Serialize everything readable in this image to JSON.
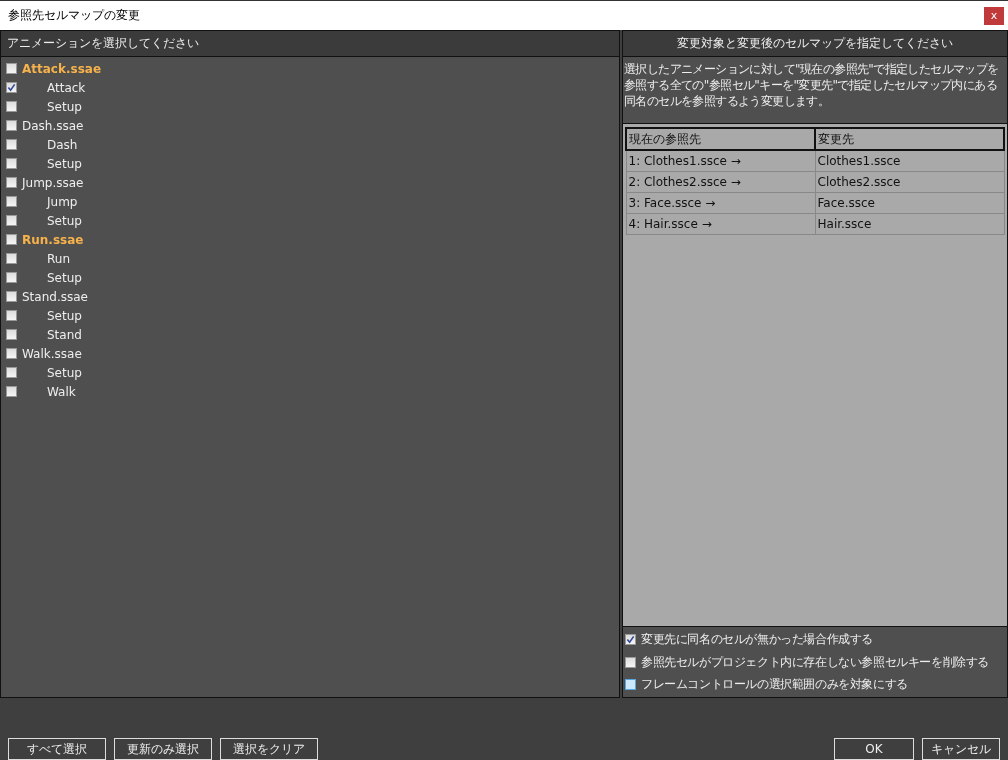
{
  "window": {
    "title": "参照先セルマップの変更",
    "close": "x"
  },
  "animation_panel": {
    "header": "アニメーションを選択してください",
    "files": [
      {
        "name": "Attack.ssae",
        "checked": false,
        "highlighted": true,
        "children": [
          {
            "name": "Attack",
            "checked": true
          },
          {
            "name": "Setup",
            "checked": false
          }
        ]
      },
      {
        "name": "Dash.ssae",
        "checked": false,
        "highlighted": false,
        "children": [
          {
            "name": "Dash",
            "checked": false
          },
          {
            "name": "Setup",
            "checked": false
          }
        ]
      },
      {
        "name": "Jump.ssae",
        "checked": false,
        "highlighted": false,
        "children": [
          {
            "name": "Jump",
            "checked": false
          },
          {
            "name": "Setup",
            "checked": false
          }
        ]
      },
      {
        "name": "Run.ssae",
        "checked": false,
        "highlighted": true,
        "children": [
          {
            "name": "Run",
            "checked": false
          },
          {
            "name": "Setup",
            "checked": false
          }
        ]
      },
      {
        "name": "Stand.ssae",
        "checked": false,
        "highlighted": false,
        "children": [
          {
            "name": "Setup",
            "checked": false
          },
          {
            "name": "Stand",
            "checked": false
          }
        ]
      },
      {
        "name": "Walk.ssae",
        "checked": false,
        "highlighted": false,
        "children": [
          {
            "name": "Setup",
            "checked": false
          },
          {
            "name": "Walk",
            "checked": false
          }
        ]
      }
    ]
  },
  "cellmap_panel": {
    "header": "変更対象と変更後のセルマップを指定してください",
    "description": [
      "選択したアニメーションに対して\"現在の参照先\"で指定したセルマップを",
      "参照する全ての\"参照セル\"キーを\"変更先\"で指定したセルマップ内にある",
      "同名のセルを参照するよう変更します。"
    ],
    "table": {
      "columns": [
        "現在の参照先",
        "変更先"
      ],
      "rows": [
        [
          "1: Clothes1.ssce  →",
          "Clothes1.ssce"
        ],
        [
          "2: Clothes2.ssce  →",
          "Clothes2.ssce"
        ],
        [
          "3: Face.ssce  →",
          "Face.ssce"
        ],
        [
          "4: Hair.ssce  →",
          "Hair.ssce"
        ]
      ]
    },
    "options": [
      {
        "label": "変更先に同名のセルが無かった場合作成する",
        "checked": true,
        "focused": false
      },
      {
        "label": "参照先セルがプロジェクト内に存在しない参照セルキーを削除する",
        "checked": false,
        "focused": false
      },
      {
        "label": "フレームコントロールの選択範囲のみを対象にする",
        "checked": false,
        "focused": true
      }
    ]
  },
  "buttons_left": [
    "すべて選択",
    "更新のみ選択",
    "選択をクリア"
  ],
  "buttons_right": [
    "OK",
    "キャンセル"
  ]
}
